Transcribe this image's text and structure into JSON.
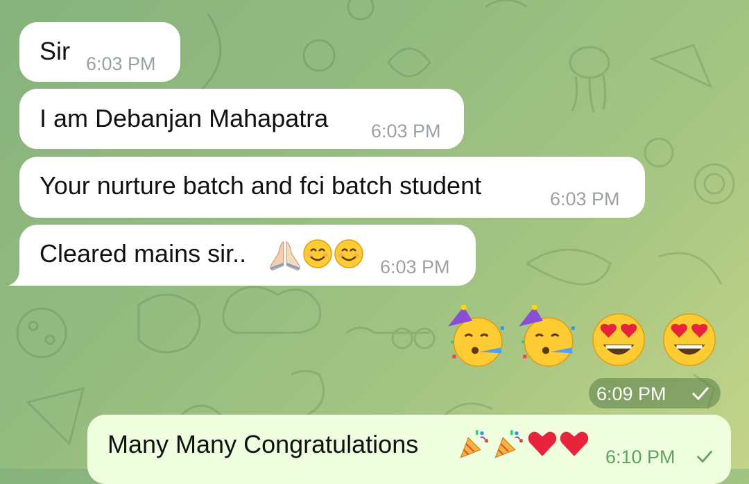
{
  "colors": {
    "incoming_bubble": "#ffffff",
    "outgoing_bubble": "#eefedf",
    "time_gray": "#9aa1a6",
    "time_green": "#5fa35c",
    "wallpaper": "#93bb80"
  },
  "messages": [
    {
      "text": "Sir",
      "time": "6:03 PM"
    },
    {
      "text": "I am Debanjan Mahapatra",
      "time": "6:03 PM"
    },
    {
      "text": "Your nurture batch and fci batch student",
      "time": "6:03 PM"
    },
    {
      "text": "Cleared mains sir..",
      "emojis": [
        "folded-hands",
        "smiling-face",
        "smiling-face"
      ],
      "time": "6:03 PM"
    }
  ],
  "outgoing": {
    "emoji_message": {
      "emojis": [
        "partying-face",
        "partying-face",
        "heart-eyes-face",
        "heart-eyes-face"
      ],
      "time": "6:09 PM",
      "status": "sent-check"
    },
    "text_message": {
      "text": "Many Many Congratulations",
      "emojis": [
        "party-popper",
        "party-popper",
        "red-heart",
        "red-heart"
      ],
      "time": "6:10 PM",
      "status": "sent-check"
    }
  }
}
